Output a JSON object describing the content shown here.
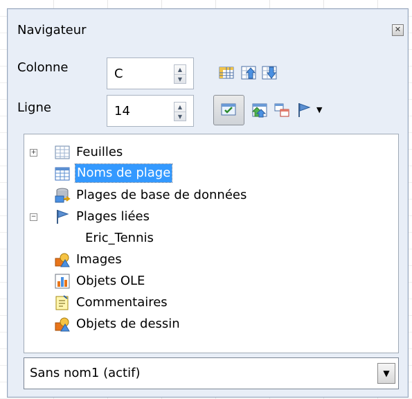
{
  "window": {
    "title": "Navigateur"
  },
  "fields": {
    "column_label": "Colonne",
    "column_value": "C",
    "row_label": "Ligne",
    "row_value": "14"
  },
  "tree": {
    "items": [
      {
        "label": "Feuilles",
        "expanded": false
      },
      {
        "label": "Noms de plage",
        "selected": true
      },
      {
        "label": "Plages de base de données"
      },
      {
        "label": "Plages liées",
        "expanded": true,
        "children": [
          {
            "label": "Eric_Tennis"
          }
        ]
      },
      {
        "label": "Images"
      },
      {
        "label": "Objets OLE"
      },
      {
        "label": "Commentaires"
      },
      {
        "label": "Objets de dessin"
      }
    ]
  },
  "document_select": {
    "value": "Sans nom1 (actif)"
  },
  "colors": {
    "panel_bg": "#e8eef7",
    "selection": "#3399ff"
  },
  "icons": [
    "data-range-icon",
    "start-icon",
    "end-icon",
    "toggle-content-icon",
    "scenarios-icon",
    "drag-mode-icon",
    "flag-icon",
    "dropdown-arrow-icon"
  ]
}
